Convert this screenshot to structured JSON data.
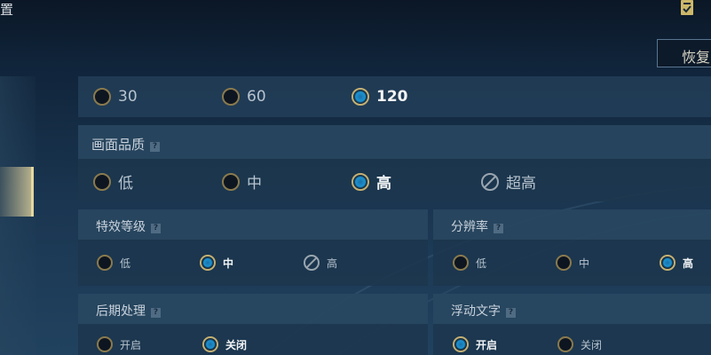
{
  "header": {
    "title": "置",
    "restore_label": "恢复"
  },
  "fps": {
    "options": [
      {
        "label": "30",
        "selected": false
      },
      {
        "label": "60",
        "selected": false
      },
      {
        "label": "120",
        "selected": true
      }
    ]
  },
  "quality": {
    "title": "画面品质",
    "help": "?",
    "options": [
      {
        "label": "低",
        "state": "normal"
      },
      {
        "label": "中",
        "state": "normal"
      },
      {
        "label": "高",
        "state": "selected"
      },
      {
        "label": "超高",
        "state": "disabled"
      }
    ]
  },
  "effects": {
    "title": "特效等级",
    "help": "?",
    "options": [
      {
        "label": "低",
        "state": "normal"
      },
      {
        "label": "中",
        "state": "selected"
      },
      {
        "label": "高",
        "state": "disabled"
      }
    ]
  },
  "resolution": {
    "title": "分辨率",
    "help": "?",
    "options": [
      {
        "label": "低",
        "state": "normal"
      },
      {
        "label": "中",
        "state": "normal"
      },
      {
        "label": "高",
        "state": "selected"
      }
    ]
  },
  "postprocess": {
    "title": "后期处理",
    "help": "?",
    "options": [
      {
        "label": "开启",
        "state": "normal"
      },
      {
        "label": "关闭",
        "state": "selected"
      }
    ]
  },
  "floating_text": {
    "title": "浮动文字",
    "help": "?",
    "options": [
      {
        "label": "开启",
        "state": "selected"
      },
      {
        "label": "关闭",
        "state": "normal"
      }
    ]
  },
  "colors": {
    "accent_gold": "#c8b070",
    "accent_blue": "#1a93d0",
    "panel": "#223e58"
  }
}
